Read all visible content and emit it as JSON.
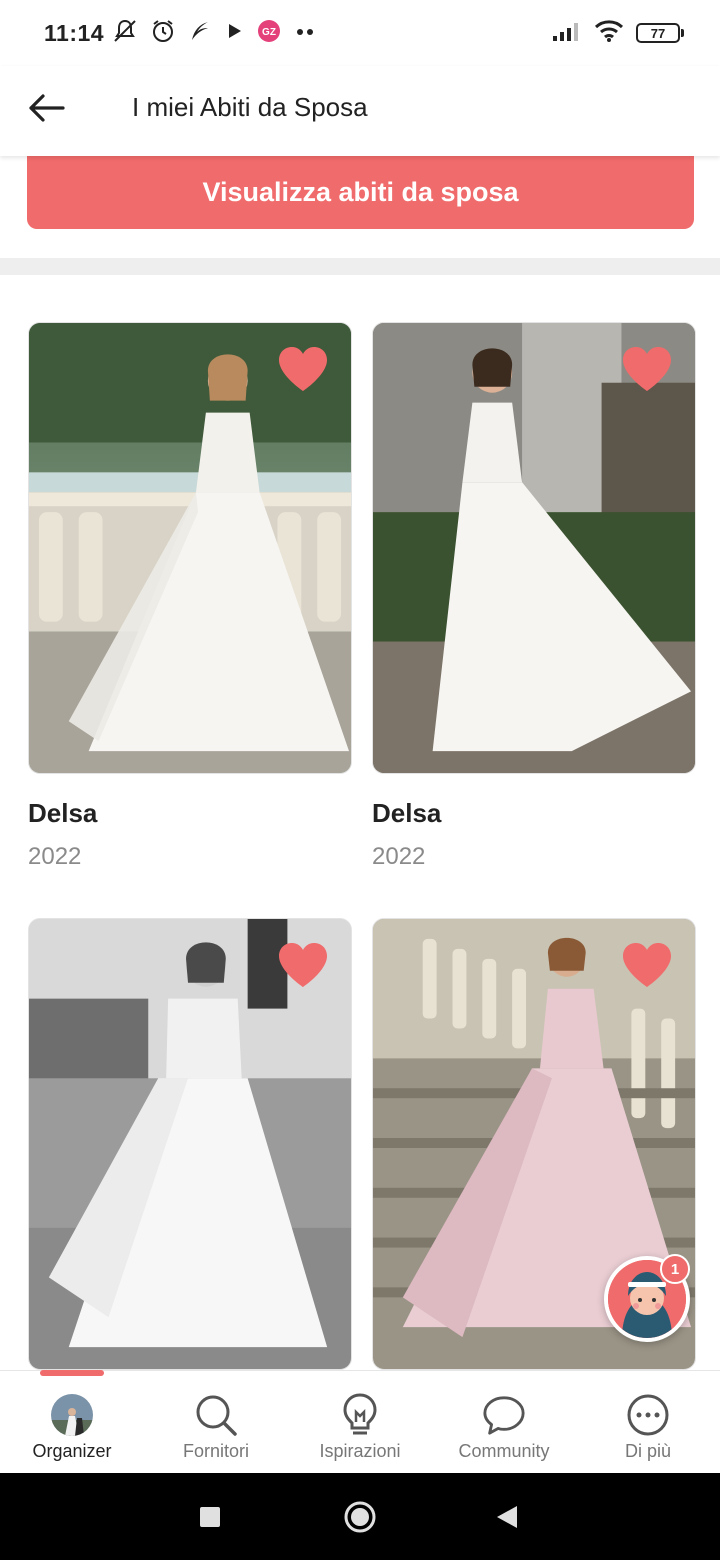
{
  "status_bar": {
    "time": "11:14",
    "left_icons": [
      "mute-alarm-icon",
      "alarm-clock-icon",
      "feather-icon",
      "play-icon",
      "gz-app-icon",
      "more-dots-icon"
    ],
    "battery": "77"
  },
  "header": {
    "title": "I miei Abiti da Sposa"
  },
  "cta": {
    "label": "Visualizza abiti da sposa"
  },
  "dresses": [
    {
      "name": "Delsa",
      "year": "2022",
      "favorite": true
    },
    {
      "name": "Delsa",
      "year": "2022",
      "favorite": true
    },
    {
      "name": "",
      "year": "",
      "favorite": true
    },
    {
      "name": "",
      "year": "",
      "favorite": true
    }
  ],
  "chat": {
    "badge": "1"
  },
  "bottom_nav": {
    "items": [
      {
        "label": "Organizer",
        "icon": "avatar-photo-icon",
        "active": true
      },
      {
        "label": "Fornitori",
        "icon": "search-icon",
        "active": false
      },
      {
        "label": "Ispirazioni",
        "icon": "lightbulb-icon",
        "active": false
      },
      {
        "label": "Community",
        "icon": "chat-bubble-icon",
        "active": false
      },
      {
        "label": "Di più",
        "icon": "more-icon",
        "active": false
      }
    ]
  },
  "colors": {
    "accent": "#f06b6b",
    "text": "#222222",
    "muted": "#8a8a8a"
  }
}
